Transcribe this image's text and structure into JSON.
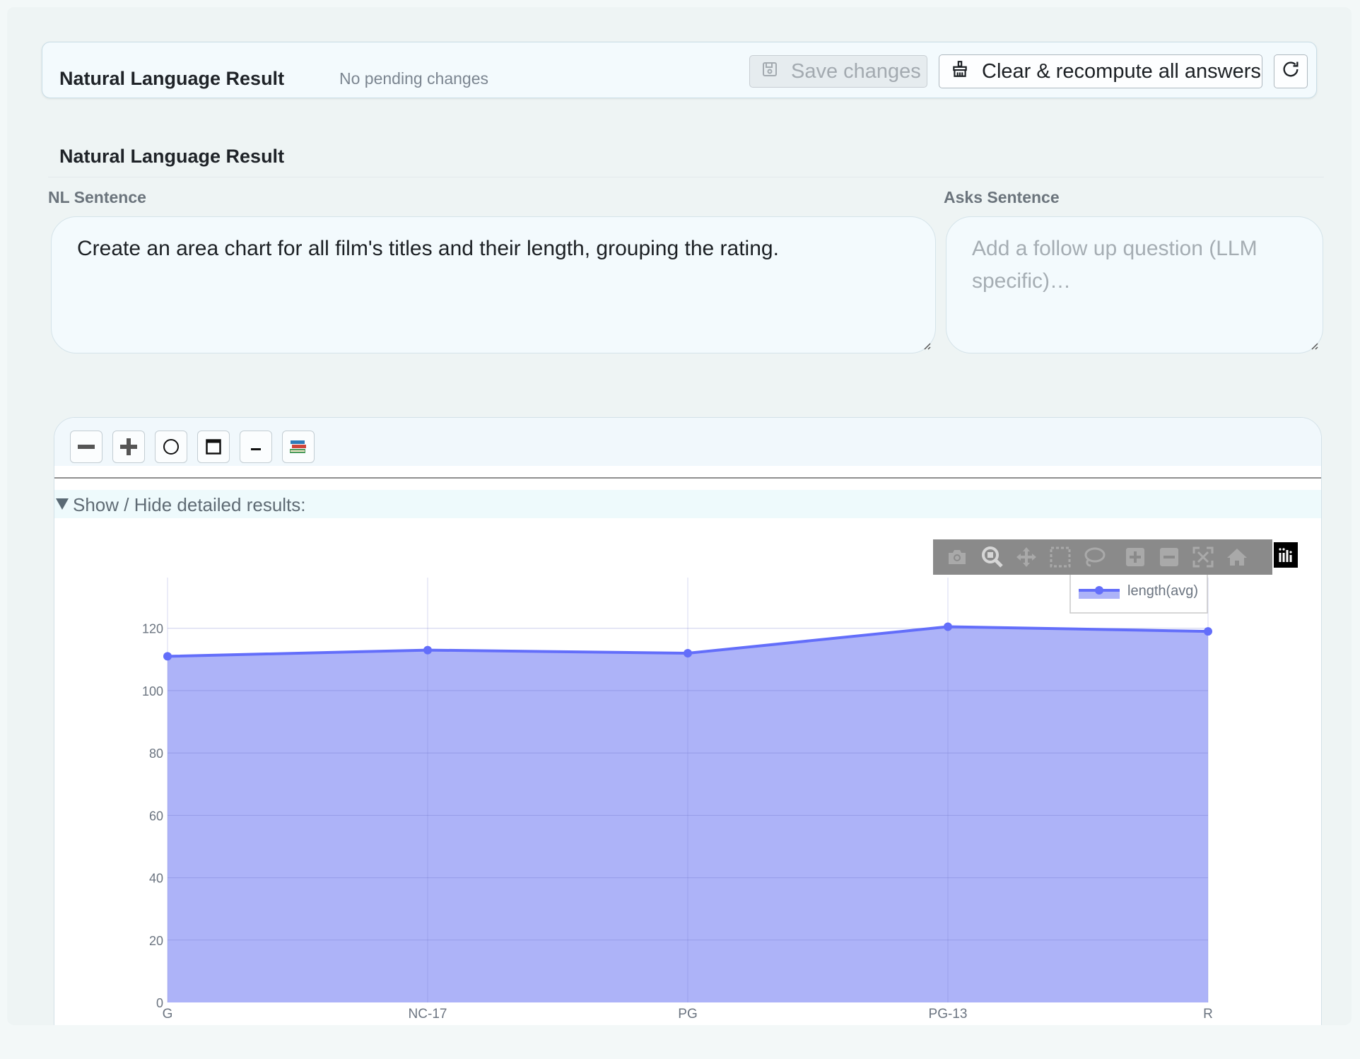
{
  "header": {
    "title": "Natural Language Result",
    "status": "No pending changes",
    "save_label": "Save changes",
    "clear_label": "Clear & recompute all answers"
  },
  "panel": {
    "title": "Natural Language Result",
    "nl_label": "NL Sentence",
    "nl_value": "Create an area chart for all film's titles and their length, grouping the rating.",
    "asks_label": "Asks Sentence",
    "asks_placeholder": "Add a follow up question (LLM specific)…"
  },
  "result": {
    "toolbar": [
      "collapse-icon",
      "expand-icon",
      "circle-icon",
      "window-icon",
      "minimize-icon",
      "books-icon"
    ],
    "details_label": "Show / Hide detailed results:"
  },
  "modebar": [
    "camera-icon",
    "zoom-icon",
    "pan-icon",
    "box-select-icon",
    "lasso-icon",
    "zoom-in-icon",
    "zoom-out-icon",
    "autoscale-icon",
    "home-icon"
  ],
  "colors": {
    "series": "#636efa",
    "fill": "#adb3f8",
    "accent_bg": "#f3fafd"
  },
  "chart_data": {
    "type": "area",
    "categories": [
      "G",
      "NC-17",
      "PG",
      "PG-13",
      "R"
    ],
    "series": [
      {
        "name": "length(avg)",
        "values": [
          111,
          113,
          112,
          120.5,
          119
        ]
      }
    ],
    "yticks": [
      0,
      20,
      40,
      60,
      80,
      100,
      120
    ],
    "ylim": [
      0,
      129
    ],
    "legend": "top-right",
    "grid": true
  }
}
